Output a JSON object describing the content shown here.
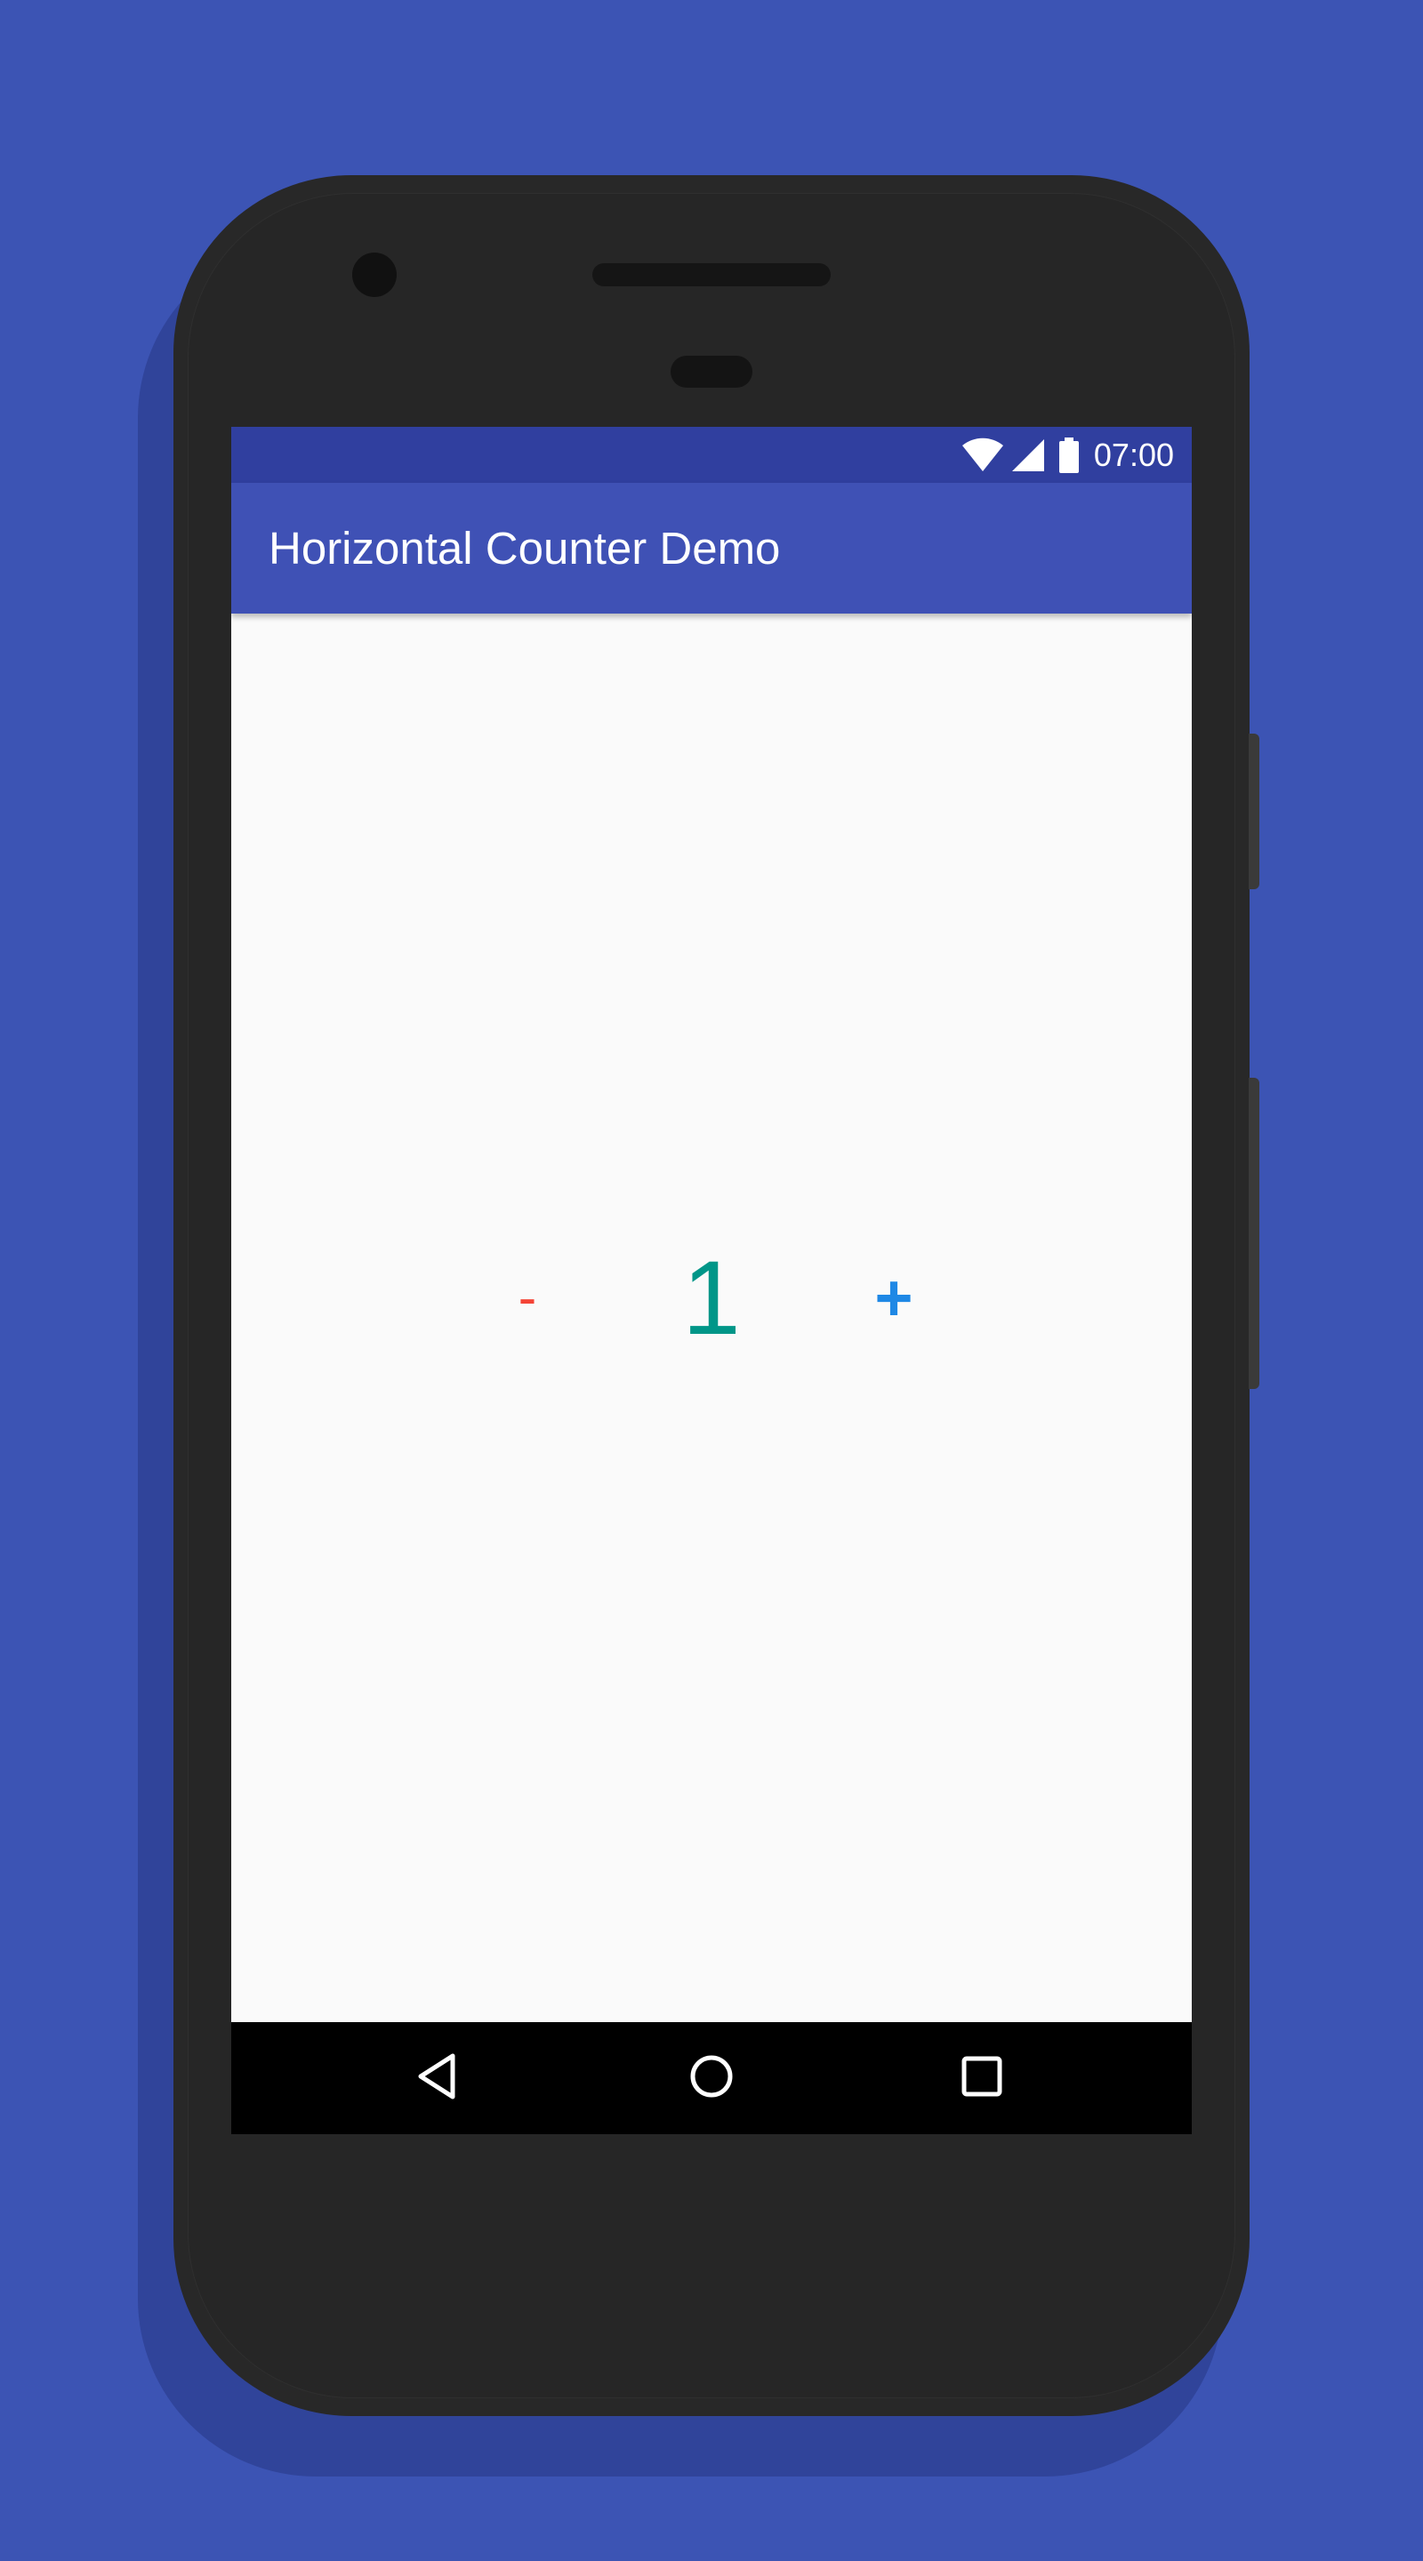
{
  "status_bar": {
    "time": "07:00",
    "icons": [
      "wifi-icon",
      "cell-signal-icon",
      "battery-icon"
    ]
  },
  "app_bar": {
    "title": "Horizontal Counter Demo"
  },
  "counter": {
    "decrement_label": "-",
    "value": "1",
    "increment_label": "+"
  },
  "nav_bar": {
    "icons": [
      "back-icon",
      "home-icon",
      "recents-icon"
    ]
  },
  "colors": {
    "background": "#3c54b4",
    "status_bar": "#303f9f",
    "app_bar": "#3f51b5",
    "decrement": "#f44336",
    "value": "#009688",
    "increment": "#1e88e5",
    "content_background": "#fafafa"
  }
}
